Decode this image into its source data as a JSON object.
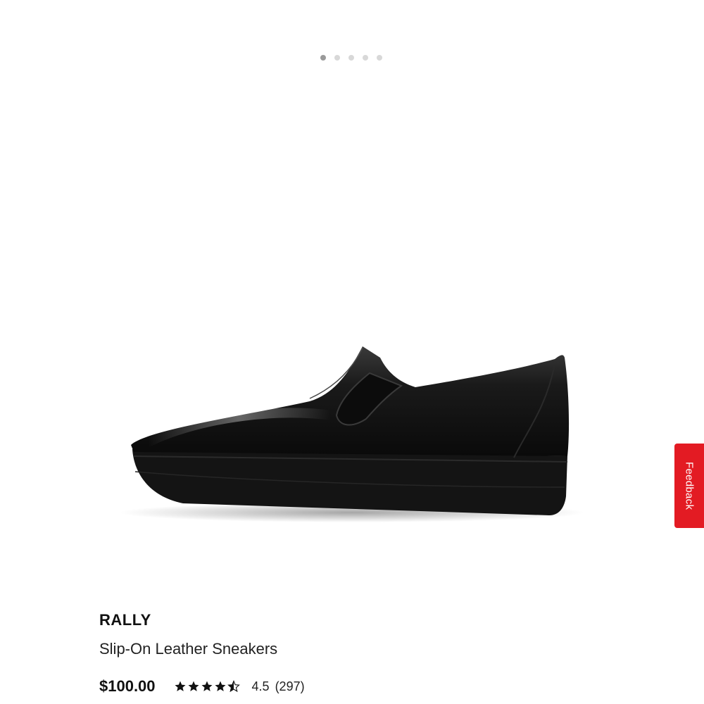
{
  "carousel": {
    "total_slides": 5,
    "active_index": 0
  },
  "product": {
    "brand": "RALLY",
    "name": "Slip-On Leather Sneakers",
    "price": "$100.00",
    "rating_value": "4.5",
    "review_count": "(297)",
    "rating_stars": 4.5,
    "image_icon": "black-slip-on-leather-sneaker"
  },
  "feedback": {
    "label": "Feedback"
  },
  "colors": {
    "feedback_red": "#e31b23",
    "dot_active": "#9a9a9a",
    "dot_inactive": "#d8d8d8",
    "text_primary": "#111111"
  }
}
